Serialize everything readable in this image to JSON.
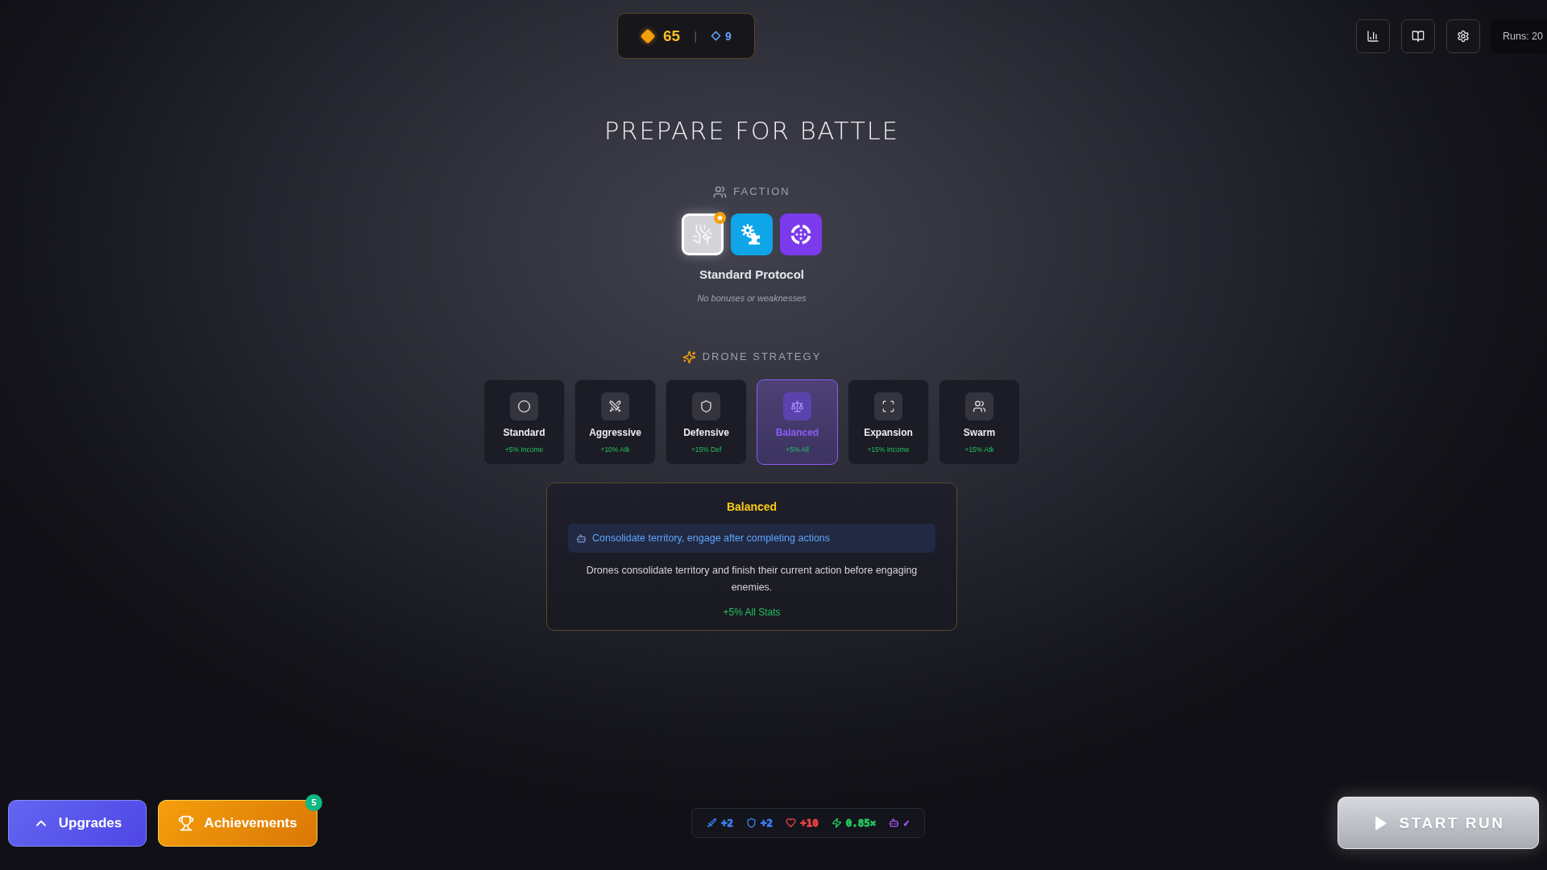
{
  "currency": {
    "gold": "65",
    "separator": "|",
    "gems": "9"
  },
  "toolbar": [
    {
      "kind": "chart"
    },
    {
      "kind": "book"
    },
    {
      "kind": "settings"
    }
  ],
  "runs": "Runs: 20",
  "title": "PREPARE FOR BATTLE",
  "faction": {
    "heading": "FACTION",
    "options": [
      {
        "kind": "circuit",
        "color": "#d4d4d8",
        "selected": true
      },
      {
        "kind": "gears",
        "color": "#0ea5e9",
        "selected": false
      },
      {
        "kind": "target",
        "color": "#7c3aed",
        "selected": false
      }
    ],
    "name": "Standard Protocol",
    "description": "No bonuses or weaknesses"
  },
  "strategy": {
    "heading": "DRONE STRATEGY",
    "options": [
      {
        "kind": "standard",
        "label": "Standard",
        "bonus": "+5% Income",
        "selected": false
      },
      {
        "kind": "aggressive",
        "label": "Aggressive",
        "bonus": "+10% Atk",
        "selected": false
      },
      {
        "kind": "defensive",
        "label": "Defensive",
        "bonus": "+15% Def",
        "selected": false
      },
      {
        "kind": "balanced",
        "label": "Balanced",
        "bonus": "+5% All",
        "selected": true
      },
      {
        "kind": "expansion",
        "label": "Expansion",
        "bonus": "+15% Income",
        "selected": false
      },
      {
        "kind": "swarm",
        "label": "Swarm",
        "bonus": "+15% Atk",
        "selected": false
      }
    ]
  },
  "details": {
    "title": "Balanced",
    "behavior": "Consolidate territory, engage after completing actions",
    "description": "Drones consolidate territory and finish their current action before engaging enemies.",
    "bonus": "+5% All Stats"
  },
  "upgrades_button": "Upgrades",
  "achievements_button": {
    "label": "Achievements",
    "badge": "5"
  },
  "stats": [
    {
      "kind": "attack",
      "value": "+2",
      "color": "#3b82f6"
    },
    {
      "kind": "defense",
      "value": "+2",
      "color": "#3b82f6"
    },
    {
      "kind": "health",
      "value": "+10",
      "color": "#ef4444"
    },
    {
      "kind": "speed",
      "value": "0.85×",
      "color": "#22c55e"
    },
    {
      "kind": "drone",
      "value": "✓",
      "color": "#a855f7"
    }
  ],
  "start_button": "START RUN"
}
